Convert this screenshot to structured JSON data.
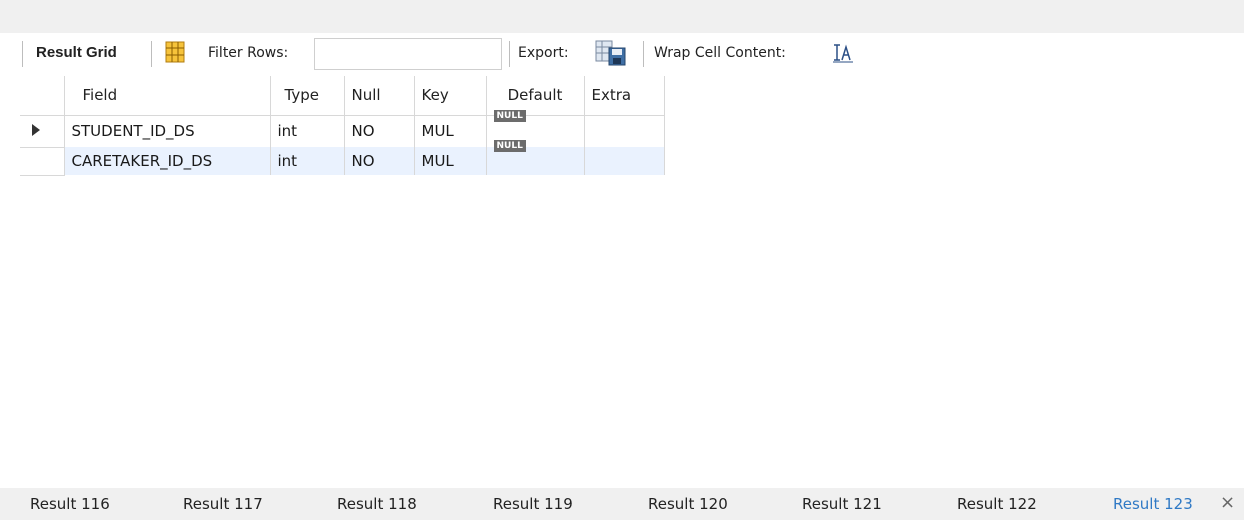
{
  "toolbar": {
    "result_grid_label": "Result Grid",
    "filter_rows_label": "Filter Rows:",
    "filter_rows_value": "",
    "export_label": "Export:",
    "wrap_label": "Wrap Cell Content:"
  },
  "grid": {
    "columns": [
      "Field",
      "Type",
      "Null",
      "Key",
      "Default",
      "Extra"
    ],
    "rows": [
      {
        "field": "STUDENT_ID_DS",
        "type": "int",
        "null": "NO",
        "key": "MUL",
        "default": "NULL",
        "extra": ""
      },
      {
        "field": "CARETAKER_ID_DS",
        "type": "int",
        "null": "NO",
        "key": "MUL",
        "default": "NULL",
        "extra": ""
      }
    ]
  },
  "tabs": [
    {
      "label": "Result 116"
    },
    {
      "label": "Result 117"
    },
    {
      "label": "Result 118"
    },
    {
      "label": "Result 119"
    },
    {
      "label": "Result 120"
    },
    {
      "label": "Result 121"
    },
    {
      "label": "Result 122"
    },
    {
      "label": "Result 123",
      "active": true
    }
  ],
  "icons": {
    "grid_icon": "result-grid-icon",
    "export_icon": "export-icon",
    "wrap_icon": "wrap-cell-icon",
    "close_icon": "close-icon",
    "row_marker": "current-row-arrow-icon"
  },
  "colors": {
    "active_tab": "#2f79c5",
    "alt_row": "#eaf2fe",
    "null_badge": "#6c6c6c"
  }
}
